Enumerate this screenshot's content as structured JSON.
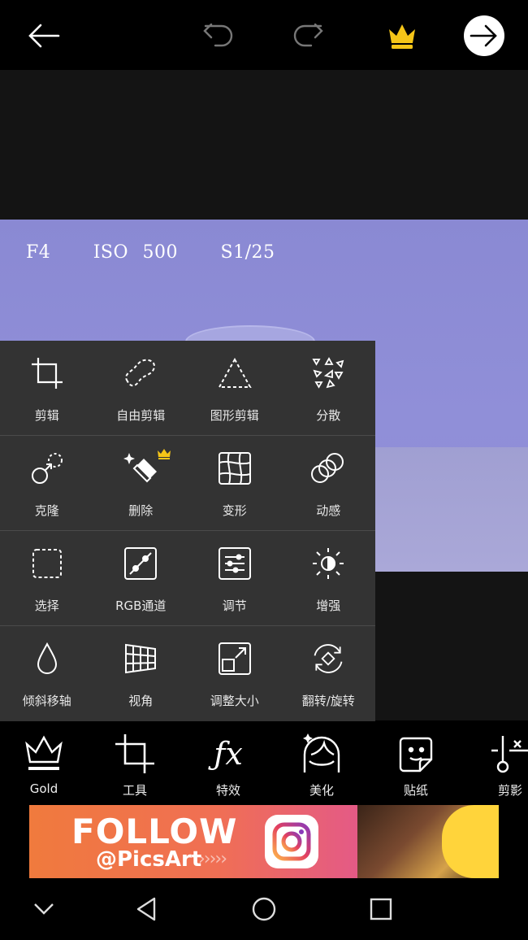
{
  "photo": {
    "exif_text": "F4   ISO 500   S1/25"
  },
  "tools": [
    [
      {
        "name": "crop",
        "label": "剪辑"
      },
      {
        "name": "free-crop",
        "label": "自由剪辑"
      },
      {
        "name": "shape-crop",
        "label": "图形剪辑"
      },
      {
        "name": "disperse",
        "label": "分散"
      }
    ],
    [
      {
        "name": "clone",
        "label": "克隆"
      },
      {
        "name": "remove",
        "label": "删除"
      },
      {
        "name": "stretch",
        "label": "变形"
      },
      {
        "name": "motion",
        "label": "动感"
      }
    ],
    [
      {
        "name": "select",
        "label": "选择"
      },
      {
        "name": "rgb-curves",
        "label": "RGB通道"
      },
      {
        "name": "adjust",
        "label": "调节"
      },
      {
        "name": "enhance",
        "label": "增强"
      }
    ],
    [
      {
        "name": "tilt-shift",
        "label": "倾斜移轴"
      },
      {
        "name": "perspective",
        "label": "视角"
      },
      {
        "name": "resize",
        "label": "调整大小"
      },
      {
        "name": "flip-rotate",
        "label": "翻转/旋转"
      }
    ]
  ],
  "bottom_tabs": [
    {
      "name": "gold",
      "label": "Gold"
    },
    {
      "name": "tools",
      "label": "工具"
    },
    {
      "name": "effects",
      "label": "特效"
    },
    {
      "name": "beautify",
      "label": "美化"
    },
    {
      "name": "sticker",
      "label": "贴纸"
    },
    {
      "name": "cutout",
      "label": "剪影"
    }
  ],
  "ad": {
    "headline": "FOLLOW",
    "handle": "@PicsArt",
    "chevrons": "›››››"
  },
  "colors": {
    "gold": "#f5c518",
    "panel": "#333333",
    "background": "#000000"
  }
}
